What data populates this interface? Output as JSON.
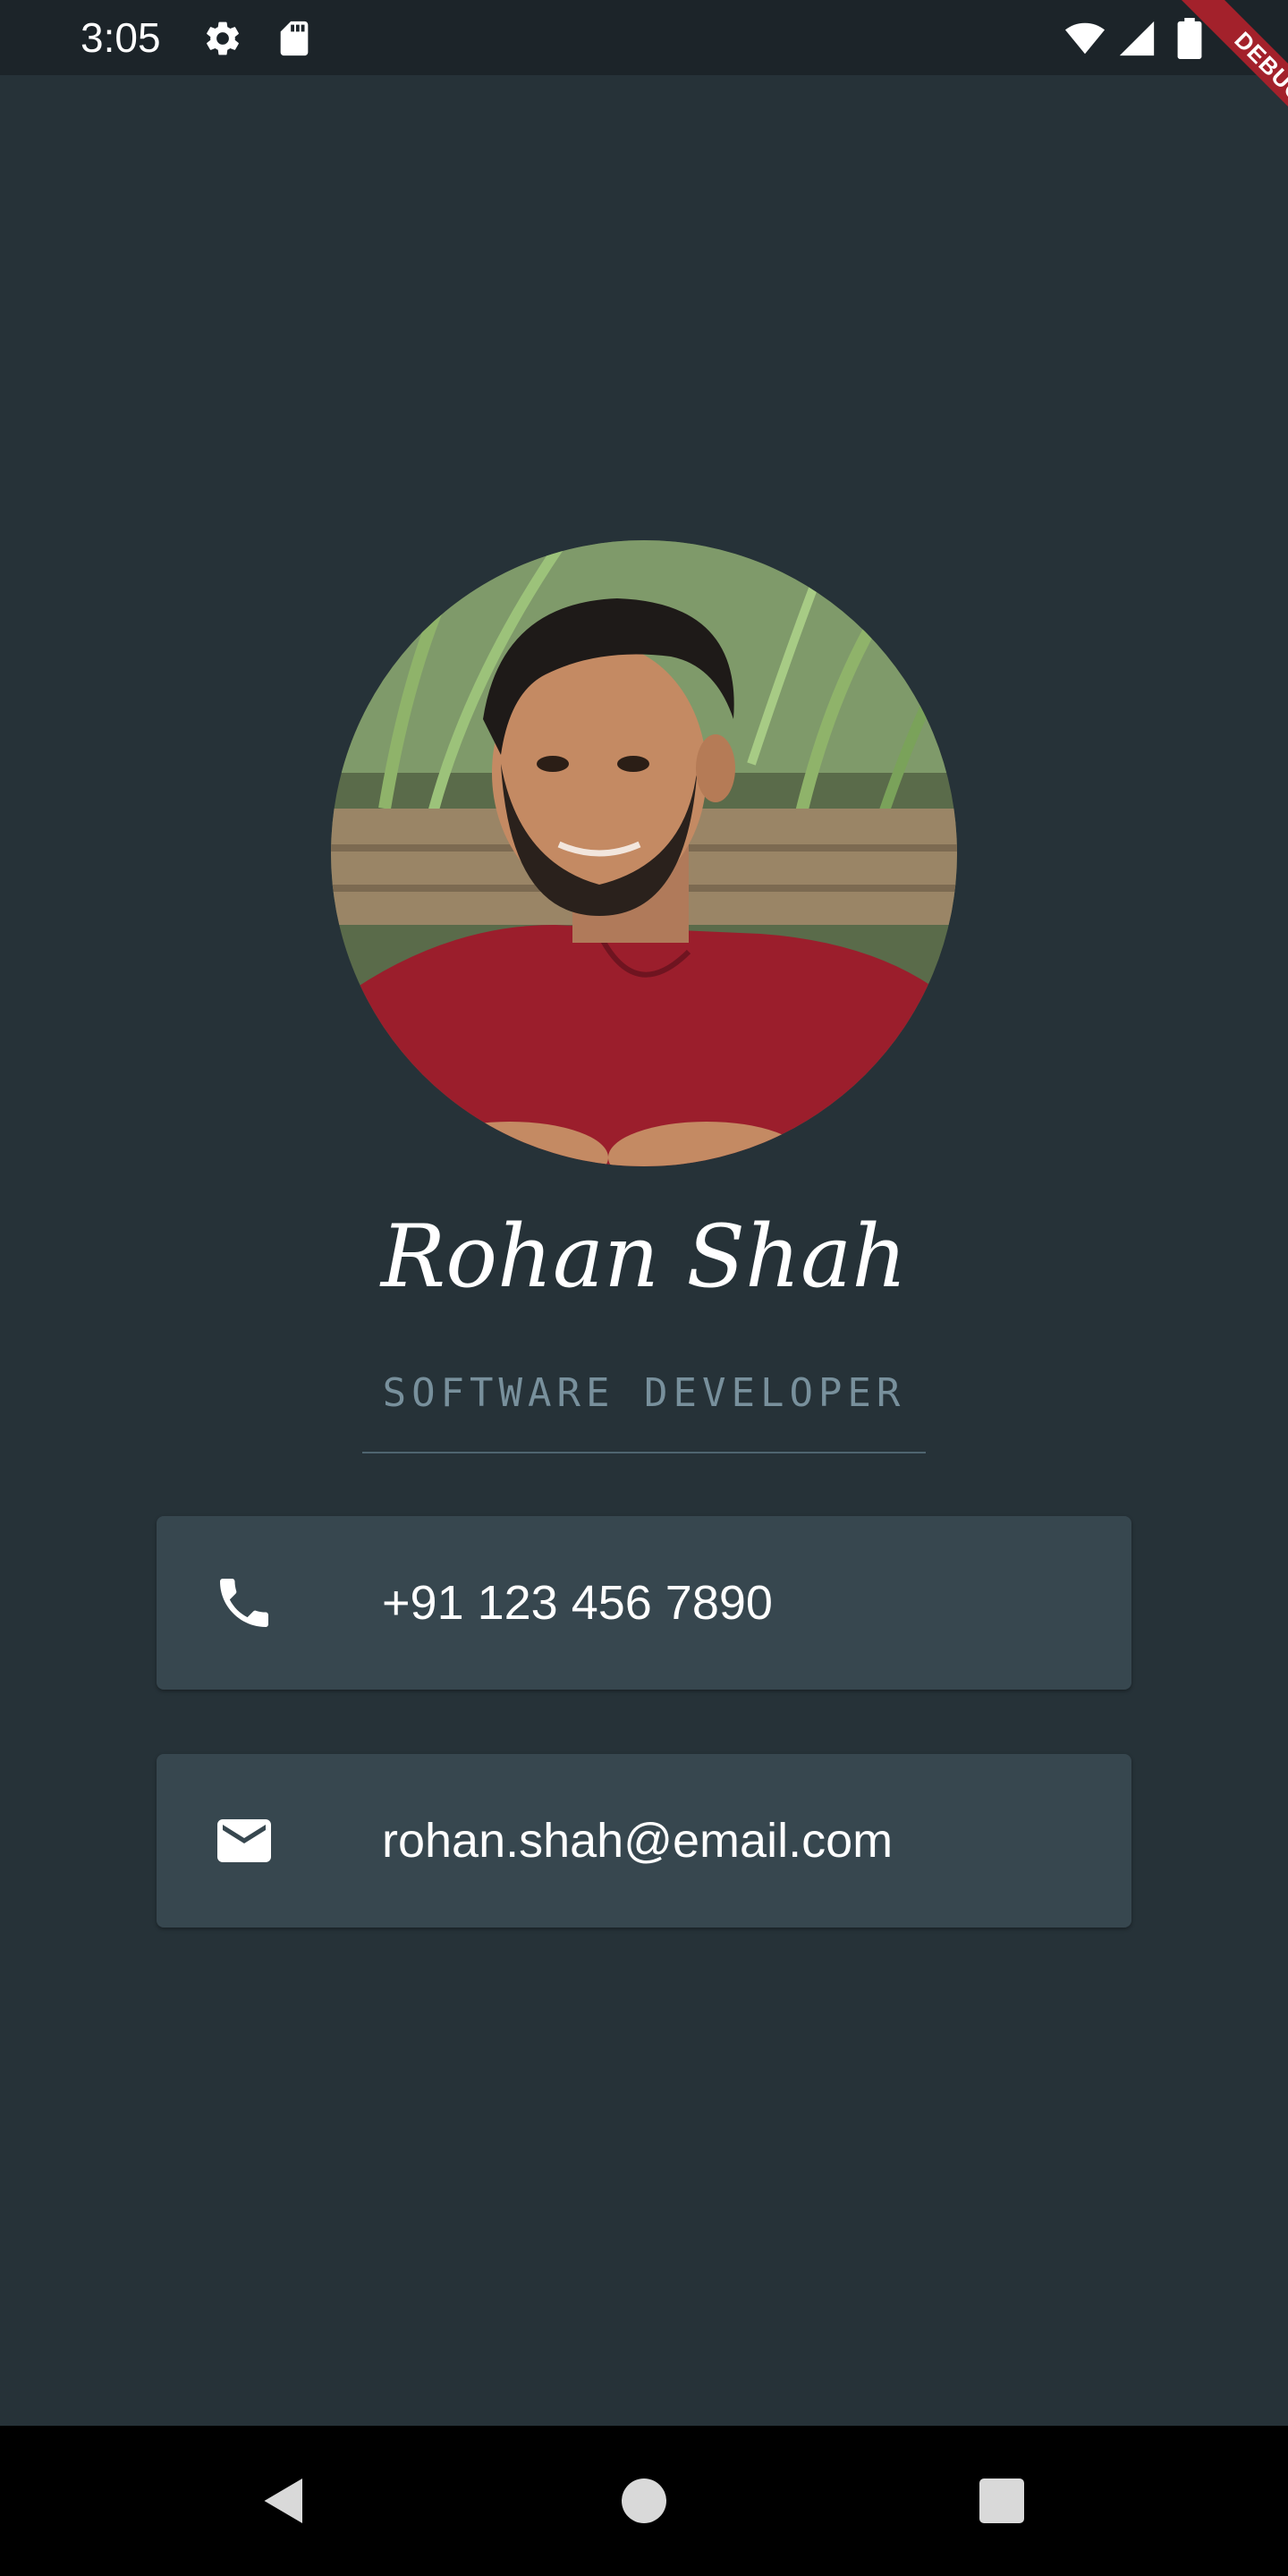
{
  "status_bar": {
    "time": "3:05",
    "left_icons": [
      "gear-icon",
      "sd-card-icon"
    ],
    "right_icons": [
      "wifi-icon",
      "signal-icon",
      "battery-icon"
    ]
  },
  "debug_banner": "DEBUG",
  "profile": {
    "name": "Rohan Shah",
    "title": "SOFTWARE DEVELOPER"
  },
  "contacts": [
    {
      "icon": "phone-icon",
      "value": "+91 123 456 7890"
    },
    {
      "icon": "mail-icon",
      "value": "rohan.shah@email.com"
    }
  ],
  "nav_bar": {
    "buttons": [
      "back-icon",
      "home-icon",
      "recents-icon"
    ]
  },
  "colors": {
    "background": "#263238",
    "card": "#37474f",
    "subtitle": "#78909c",
    "debug_banner": "#a3212b"
  }
}
